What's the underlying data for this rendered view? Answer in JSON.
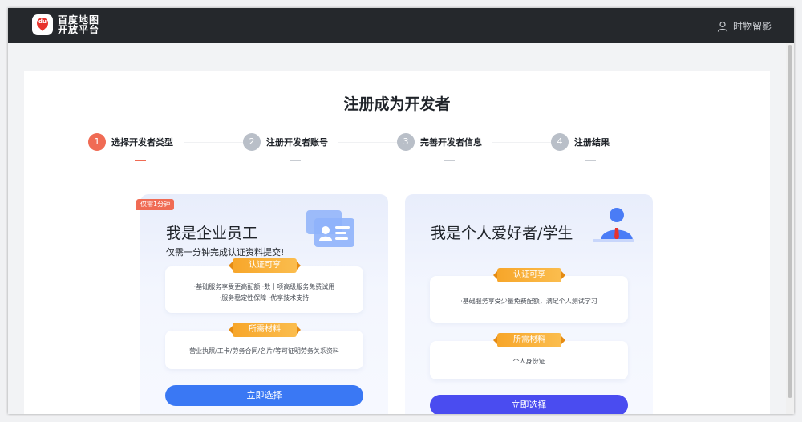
{
  "header": {
    "logo_line1": "百度地图",
    "logo_line2": "开放平台",
    "logo_badge": "du",
    "user_name": "时物留影"
  },
  "page": {
    "title": "注册成为开发者"
  },
  "steps": [
    {
      "num": "1",
      "label": "选择开发者类型",
      "active": true
    },
    {
      "num": "2",
      "label": "注册开发者账号",
      "active": false
    },
    {
      "num": "3",
      "label": "完善开发者信息",
      "active": false
    },
    {
      "num": "4",
      "label": "注册结果",
      "active": false
    }
  ],
  "enterprise": {
    "tag": "仅需1分钟",
    "title": "我是企业员工",
    "subtitle": "仅需一分钟完成认证资料提交!",
    "benefit_ribbon": "认证可享",
    "benefit_line1": "·基础服务享受更高配额 ·数十项高级服务免费试用",
    "benefit_line2": "·服务稳定性保障 ·优享技术支持",
    "material_ribbon": "所需材料",
    "material_text": "营业执照/工卡/劳务合同/名片/等可证明劳务关系资料",
    "button": "立即选择"
  },
  "personal": {
    "title": "我是个人爱好者/学生",
    "benefit_ribbon": "认证可享",
    "benefit_text": "·基础服务享受少量免费配额，满足个人测试学习",
    "material_ribbon": "所需材料",
    "material_text": "个人身份证",
    "button": "立即选择"
  },
  "colors": {
    "accent_active": "#f06b54",
    "enterprise_button": "#3a78f4",
    "personal_button": "#4a4cf0",
    "ribbon": "#f7a62a",
    "topbar": "#25282c"
  }
}
